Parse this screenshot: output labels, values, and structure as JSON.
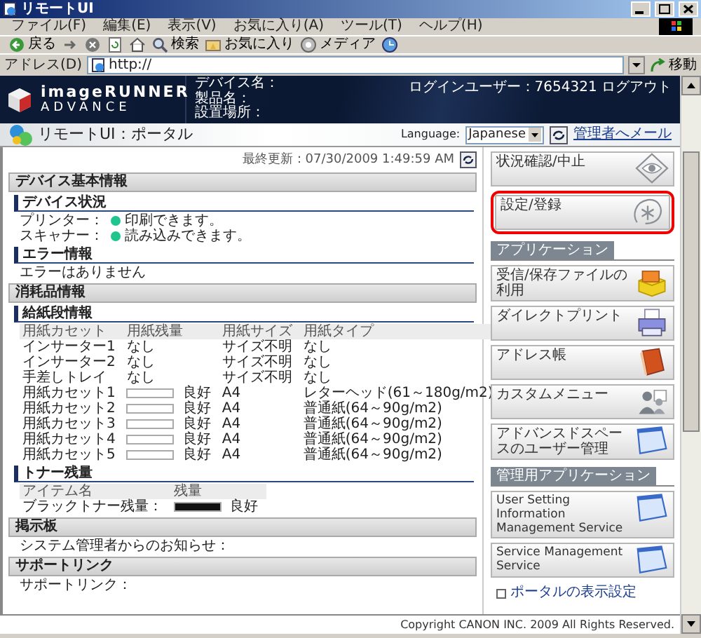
{
  "window": {
    "title": "リモートUI"
  },
  "menu": [
    "ファイル(F)",
    "編集(E)",
    "表示(V)",
    "お気に入り(A)",
    "ツール(T)",
    "ヘルプ(H)"
  ],
  "toolbar": [
    {
      "kind": "back",
      "label": "戻る"
    },
    {
      "kind": "forward"
    },
    {
      "kind": "stop"
    },
    {
      "kind": "refresh"
    },
    {
      "kind": "home"
    },
    {
      "kind": "search",
      "label": "検索"
    },
    {
      "kind": "favorites",
      "label": "お気に入り"
    },
    {
      "kind": "media",
      "label": "メディア"
    },
    {
      "kind": "history"
    }
  ],
  "address": {
    "label": "アドレス(D)",
    "value": "http://",
    "go": "移動"
  },
  "header": {
    "logo": [
      "imageRUNNER",
      "ADVANCE"
    ],
    "device_fields": [
      "デバイス名：",
      "製品名：",
      "設置場所："
    ],
    "login": "ログインユーザー：7654321",
    "logout": "ログアウト"
  },
  "portal_bar": {
    "title": "リモートUI：ポータル",
    "language_label": "Language:",
    "language": "Japanese",
    "mail_link": "管理者へメール"
  },
  "last_updated": "最終更新：07/30/2009 1:49:59 AM",
  "sections": [
    {
      "title": "デバイス基本情報",
      "blocks": [
        {
          "kind": "status",
          "title": "デバイス状況",
          "rows": [
            {
              "label": "プリンター：",
              "text": "印刷できます。",
              "color": "#1fc48f"
            },
            {
              "label": "スキャナー：",
              "text": "読み込みできます。",
              "color": "#1fc48f"
            }
          ]
        },
        {
          "kind": "text",
          "title": "エラー情報",
          "text": "エラーはありません"
        }
      ]
    },
    {
      "title": "消耗品情報",
      "blocks": [
        {
          "kind": "paper",
          "title": "給紙段情報",
          "columns": [
            "用紙カセット",
            "用紙残量",
            "用紙サイズ",
            "用紙タイプ"
          ],
          "rows": [
            {
              "kind": "tray",
              "name": "インサーター1",
              "remaining": "なし",
              "size": "サイズ不明",
              "type": "なし"
            },
            {
              "kind": "tray",
              "name": "インサーター2",
              "remaining": "なし",
              "size": "サイズ不明",
              "type": "なし"
            },
            {
              "kind": "tray",
              "name": "手差しトレイ",
              "remaining": "なし",
              "size": "サイズ不明",
              "type": "なし"
            },
            {
              "kind": "cassette",
              "name": "用紙カセット1",
              "level": 0,
              "remaining": "良好",
              "size": "A4",
              "type": "レターヘッド(61～180g/m2)"
            },
            {
              "kind": "cassette",
              "name": "用紙カセット2",
              "level": 0,
              "remaining": "良好",
              "size": "A4",
              "type": "普通紙(64～90g/m2)"
            },
            {
              "kind": "cassette",
              "name": "用紙カセット3",
              "level": 0,
              "remaining": "良好",
              "size": "A4",
              "type": "普通紙(64～90g/m2)"
            },
            {
              "kind": "cassette",
              "name": "用紙カセット4",
              "level": 0,
              "remaining": "良好",
              "size": "A4",
              "type": "普通紙(64～90g/m2)"
            },
            {
              "kind": "cassette",
              "name": "用紙カセット5",
              "level": 0,
              "remaining": "良好",
              "size": "A4",
              "type": "普通紙(64～90g/m2)"
            }
          ]
        },
        {
          "kind": "toner",
          "title": "トナー残量",
          "columns": [
            "アイテム名",
            "残量"
          ],
          "rows": [
            {
              "name": "ブラックトナー残量：",
              "level": 1,
              "remaining": "良好"
            }
          ]
        }
      ]
    },
    {
      "title": "掲示板",
      "blocks": [
        {
          "kind": "text",
          "text": "システム管理者からのお知らせ："
        }
      ]
    },
    {
      "title": "サポートリンク",
      "blocks": [
        {
          "kind": "text",
          "text": "サポートリンク："
        }
      ]
    }
  ],
  "menu_buttons": [
    {
      "label": "状況確認/中止",
      "highlighted": false
    },
    {
      "label": "設定/登録",
      "highlighted": true
    }
  ],
  "groups": [
    {
      "title": "アプリケーション",
      "buttons": [
        {
          "label": "受信/保存ファイルの利用"
        },
        {
          "label": "ダイレクトプリント"
        },
        {
          "label": "アドレス帳"
        },
        {
          "label": "カスタムメニュー"
        },
        {
          "label": "アドバンスドスペースのユーザー管理"
        }
      ]
    },
    {
      "title": "管理用アプリケーション",
      "buttons": [
        {
          "label": "User Setting Information Management Service"
        },
        {
          "label": "Service Management Service"
        }
      ]
    }
  ],
  "portal_settings": "ポータルの表示設定",
  "copyright": "Copyright CANON INC. 2009 All Rights Reserved."
}
